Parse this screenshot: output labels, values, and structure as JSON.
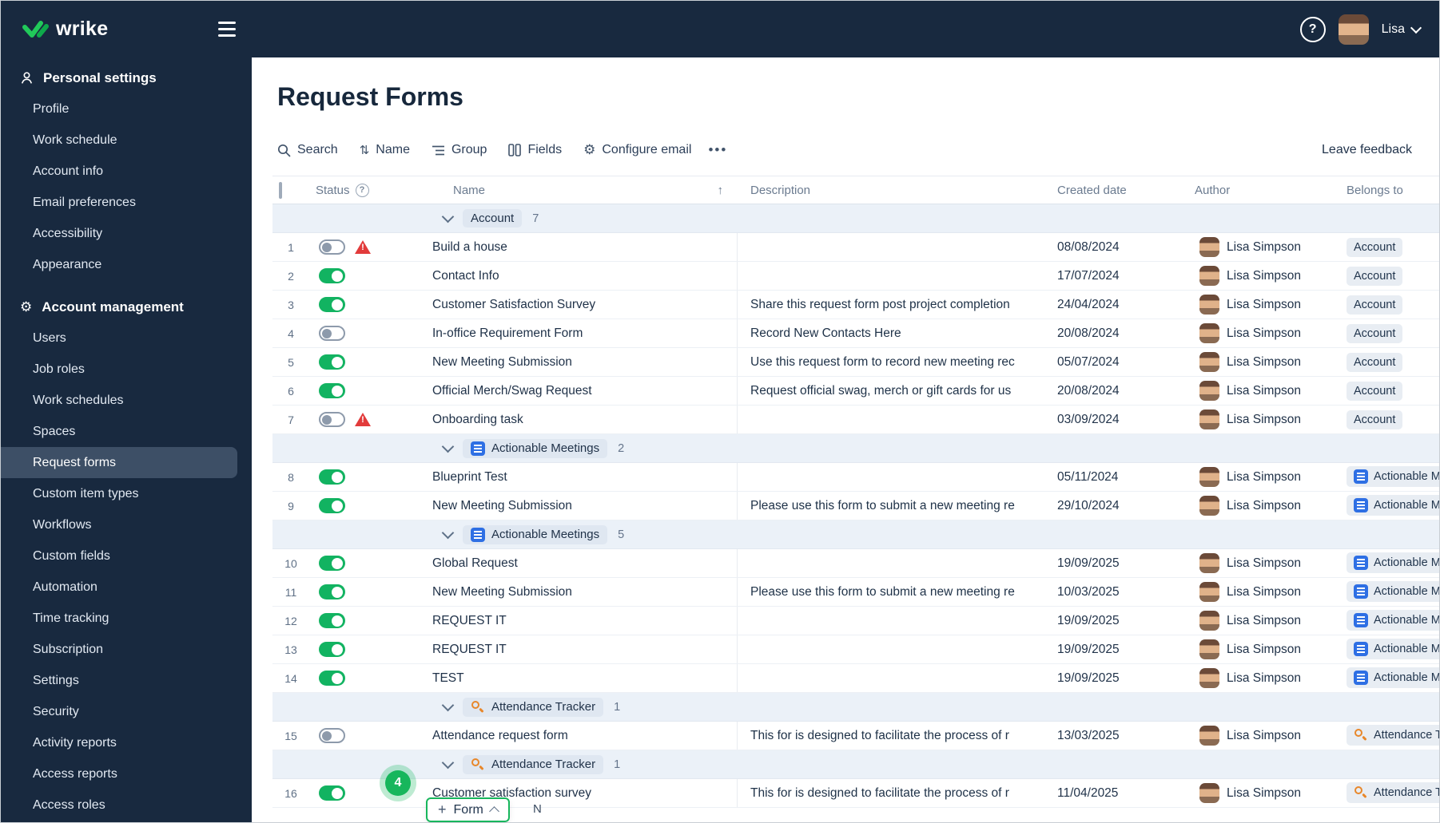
{
  "topbar": {
    "logo_text": "wrike",
    "user_name": "Lisa"
  },
  "icons": {
    "gear": "⚙",
    "sort": "⇅",
    "sort_asc": "↑",
    "more": "•••",
    "help": "?",
    "plus": "+",
    "warning": "!"
  },
  "colors": {
    "brand_navy": "#18293f",
    "accent_green": "#17b65c",
    "toggle_green": "#12b361",
    "warning_red": "#e23b3b",
    "space_blue": "#2e6fe4",
    "space_orange": "#e8872a"
  },
  "sidebar": {
    "sections": [
      {
        "title": "Personal settings",
        "items": [
          "Profile",
          "Work schedule",
          "Account info",
          "Email preferences",
          "Accessibility",
          "Appearance"
        ]
      },
      {
        "title": "Account management",
        "items": [
          "Users",
          "Job roles",
          "Work schedules",
          "Spaces",
          "Request forms",
          "Custom item types",
          "Workflows",
          "Custom fields",
          "Automation",
          "Time tracking",
          "Subscription",
          "Settings",
          "Security",
          "Activity reports",
          "Access reports",
          "Access roles"
        ]
      }
    ],
    "selected_item": "Request forms"
  },
  "page": {
    "title": "Request Forms"
  },
  "toolbar": {
    "search": "Search",
    "sort": "Name",
    "group": "Group",
    "fields": "Fields",
    "configure_email": "Configure email",
    "leave_feedback": "Leave feedback"
  },
  "table": {
    "columns": {
      "status": "Status",
      "name": "Name",
      "description": "Description",
      "created": "Created date",
      "author": "Author",
      "belongs": "Belongs to"
    },
    "rows": [
      {
        "kind": "group",
        "space": "",
        "label": "Account",
        "count": "7"
      },
      {
        "kind": "item",
        "num": "1",
        "status": "off",
        "warning": true,
        "name": "Build a house",
        "description": "",
        "created": "08/08/2024",
        "author": "Lisa Simpson",
        "space": "",
        "belongs": "Account"
      },
      {
        "kind": "item",
        "num": "2",
        "status": "on",
        "warning": false,
        "name": "Contact Info",
        "description": "",
        "created": "17/07/2024",
        "author": "Lisa Simpson",
        "space": "",
        "belongs": "Account"
      },
      {
        "kind": "item",
        "num": "3",
        "status": "on",
        "warning": false,
        "name": "Customer Satisfaction Survey",
        "description": "Share this request form post project completion",
        "created": "24/04/2024",
        "author": "Lisa Simpson",
        "space": "",
        "belongs": "Account"
      },
      {
        "kind": "item",
        "num": "4",
        "status": "off",
        "warning": false,
        "name": "In-office Requirement Form",
        "description": "Record New Contacts Here",
        "created": "20/08/2024",
        "author": "Lisa Simpson",
        "space": "",
        "belongs": "Account"
      },
      {
        "kind": "item",
        "num": "5",
        "status": "on",
        "warning": false,
        "name": "New Meeting Submission",
        "description": "Use this request form to record new meeting rec",
        "created": "05/07/2024",
        "author": "Lisa Simpson",
        "space": "",
        "belongs": "Account"
      },
      {
        "kind": "item",
        "num": "6",
        "status": "on",
        "warning": false,
        "name": "Official Merch/Swag Request",
        "description": "Request official swag, merch or gift cards for us",
        "created": "20/08/2024",
        "author": "Lisa Simpson",
        "space": "",
        "belongs": "Account"
      },
      {
        "kind": "item",
        "num": "7",
        "status": "off",
        "warning": true,
        "name": "Onboarding task",
        "description": "",
        "created": "03/09/2024",
        "author": "Lisa Simpson",
        "space": "",
        "belongs": "Account"
      },
      {
        "kind": "group",
        "space": "blue",
        "label": "Actionable Meetings",
        "count": "2"
      },
      {
        "kind": "item",
        "num": "8",
        "status": "on",
        "warning": false,
        "name": "Blueprint Test",
        "description": "",
        "created": "05/11/2024",
        "author": "Lisa Simpson",
        "space": "blue",
        "belongs": "Actionable Meetings"
      },
      {
        "kind": "item",
        "num": "9",
        "status": "on",
        "warning": false,
        "name": "New Meeting Submission",
        "description": "Please use this form to submit a new meeting re",
        "created": "29/10/2024",
        "author": "Lisa Simpson",
        "space": "blue",
        "belongs": "Actionable Meetings"
      },
      {
        "kind": "group",
        "space": "blue",
        "label": "Actionable Meetings",
        "count": "5"
      },
      {
        "kind": "item",
        "num": "10",
        "status": "on",
        "warning": false,
        "name": "Global Request",
        "description": "",
        "created": "19/09/2025",
        "author": "Lisa Simpson",
        "space": "blue",
        "belongs": "Actionable Meetings"
      },
      {
        "kind": "item",
        "num": "11",
        "status": "on",
        "warning": false,
        "name": "New Meeting Submission",
        "description": "Please use this form to submit a new meeting re",
        "created": "10/03/2025",
        "author": "Lisa Simpson",
        "space": "blue",
        "belongs": "Actionable Meetings"
      },
      {
        "kind": "item",
        "num": "12",
        "status": "on",
        "warning": false,
        "name": "REQUEST IT",
        "description": "",
        "created": "19/09/2025",
        "author": "Lisa Simpson",
        "space": "blue",
        "belongs": "Actionable Meetings"
      },
      {
        "kind": "item",
        "num": "13",
        "status": "on",
        "warning": false,
        "name": "REQUEST IT",
        "description": "",
        "created": "19/09/2025",
        "author": "Lisa Simpson",
        "space": "blue",
        "belongs": "Actionable Meetings"
      },
      {
        "kind": "item",
        "num": "14",
        "status": "on",
        "warning": false,
        "name": "TEST",
        "description": "",
        "created": "19/09/2025",
        "author": "Lisa Simpson",
        "space": "blue",
        "belongs": "Actionable Meetings"
      },
      {
        "kind": "group",
        "space": "orange",
        "label": "Attendance Tracker",
        "count": "1"
      },
      {
        "kind": "item",
        "num": "15",
        "status": "off",
        "warning": false,
        "name": "Attendance request form",
        "description": "This for is designed to facilitate the process of r",
        "created": "13/03/2025",
        "author": "Lisa Simpson",
        "space": "orange",
        "belongs": "Attendance Tracker"
      },
      {
        "kind": "group",
        "space": "orange",
        "label": "Attendance Tracker",
        "count": "1"
      },
      {
        "kind": "item",
        "num": "16",
        "status": "on",
        "warning": false,
        "name": "Customer satisfaction survey",
        "description": "This for is designed to facilitate the process of r",
        "created": "11/04/2025",
        "author": "Lisa Simpson",
        "space": "orange",
        "belongs": "Attendance Tracker"
      }
    ]
  },
  "annotation": {
    "badge": "4",
    "button_label": "Form",
    "shortcut_hint": "N"
  }
}
